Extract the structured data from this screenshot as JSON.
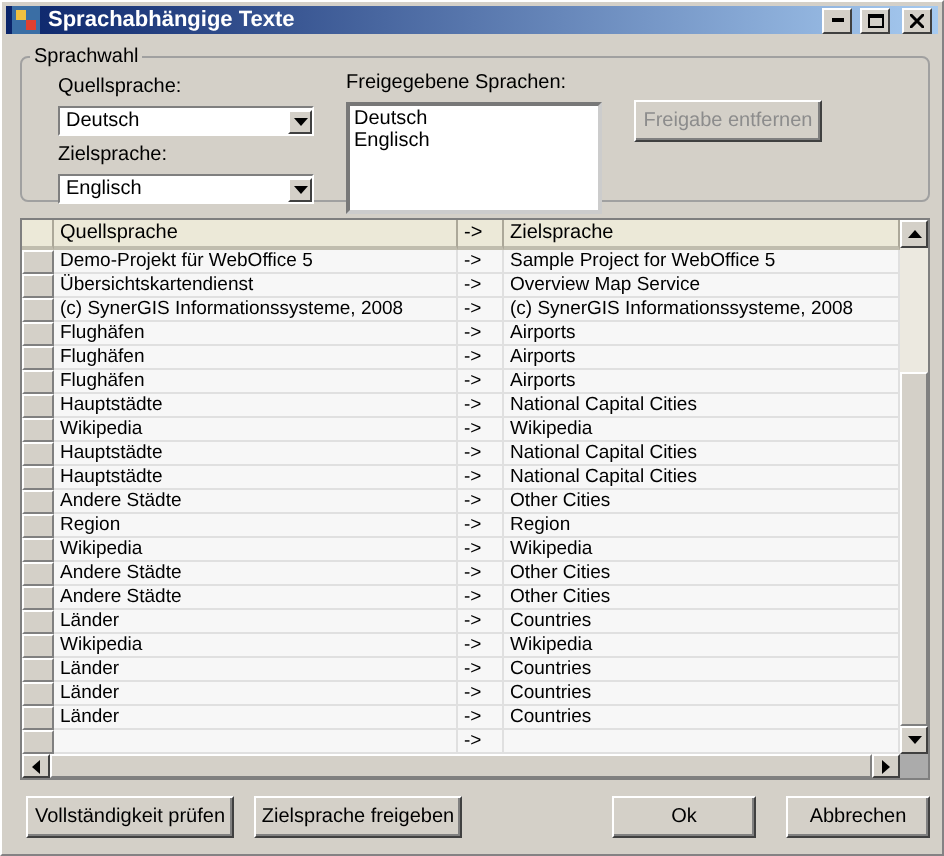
{
  "window": {
    "title": "Sprachabhängige Texte"
  },
  "language_group": {
    "legend": "Sprachwahl",
    "source_label": "Quellsprache:",
    "source_value": "Deutsch",
    "target_label": "Zielsprache:",
    "target_value": "Englisch",
    "released_label": "Freigegebene Sprachen:",
    "released_languages": [
      "Deutsch",
      "Englisch"
    ],
    "remove_button": {
      "label": "Freigabe entfernen",
      "disabled": true
    }
  },
  "table": {
    "columns": [
      "Quellsprache",
      "->",
      "Zielsprache"
    ],
    "rows": [
      {
        "source": "Demo-Projekt für WebOffice 5",
        "arrow": "->",
        "target": "Sample Project for WebOffice 5"
      },
      {
        "source": "Übersichtskartendienst",
        "arrow": "->",
        "target": "Overview Map Service"
      },
      {
        "source": "(c) SynerGIS Informationssysteme, 2008",
        "arrow": "->",
        "target": "(c) SynerGIS Informationssysteme, 2008"
      },
      {
        "source": "Flughäfen",
        "arrow": "->",
        "target": "Airports"
      },
      {
        "source": "Flughäfen",
        "arrow": "->",
        "target": "Airports"
      },
      {
        "source": "Flughäfen",
        "arrow": "->",
        "target": "Airports"
      },
      {
        "source": "Hauptstädte",
        "arrow": "->",
        "target": "National Capital Cities"
      },
      {
        "source": "Wikipedia",
        "arrow": "->",
        "target": "Wikipedia"
      },
      {
        "source": "Hauptstädte",
        "arrow": "->",
        "target": "National Capital Cities"
      },
      {
        "source": "Hauptstädte",
        "arrow": "->",
        "target": "National Capital Cities"
      },
      {
        "source": "Andere Städte",
        "arrow": "->",
        "target": "Other Cities"
      },
      {
        "source": "Region",
        "arrow": "->",
        "target": "Region"
      },
      {
        "source": "Wikipedia",
        "arrow": "->",
        "target": "Wikipedia"
      },
      {
        "source": "Andere Städte",
        "arrow": "->",
        "target": "Other Cities"
      },
      {
        "source": "Andere Städte",
        "arrow": "->",
        "target": "Other Cities"
      },
      {
        "source": "Länder",
        "arrow": "->",
        "target": "Countries"
      },
      {
        "source": "Wikipedia",
        "arrow": "->",
        "target": "Wikipedia"
      },
      {
        "source": "Länder",
        "arrow": "->",
        "target": "Countries"
      },
      {
        "source": "Länder",
        "arrow": "->",
        "target": "Countries"
      },
      {
        "source": "Länder",
        "arrow": "->",
        "target": "Countries"
      },
      {
        "arrow": "->"
      }
    ]
  },
  "left_buttons": [
    "Vollständigkeit prüfen",
    "Zielsprache freigeben"
  ],
  "right_buttons": [
    "Ok",
    "Abbrechen"
  ]
}
